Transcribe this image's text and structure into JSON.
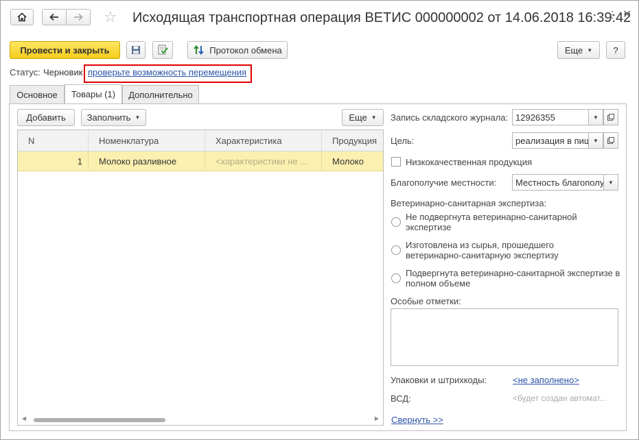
{
  "window": {
    "title": "Исходящая транспортная операция ВЕТИС 000000002 от 14.06.2018 16:39:42"
  },
  "toolbar": {
    "post_close_label": "Провести и закрыть",
    "protocol_label": "Протокол обмена",
    "more_label": "Еще",
    "help_label": "?"
  },
  "status": {
    "label": "Статус:",
    "value": "Черновик",
    "link": "проверьте возможность перемещения"
  },
  "tabs": [
    {
      "label": "Основное"
    },
    {
      "label": "Товары (1)"
    },
    {
      "label": "Дополнительно"
    }
  ],
  "table_toolbar": {
    "add_label": "Добавить",
    "fill_label": "Заполнить",
    "more_label": "Еще"
  },
  "table": {
    "columns": [
      "N",
      "Номенклатура",
      "Характеристика",
      "Продукция"
    ],
    "rows": [
      {
        "n": "1",
        "nomenclature": "Молоко разливное",
        "characteristic": "<характеристики не ...",
        "product": "Молоко"
      }
    ]
  },
  "details": {
    "warehouse_label": "Запись складского журнала:",
    "warehouse_value": "12926355",
    "purpose_label": "Цель:",
    "purpose_value": "реализация в пищ",
    "low_quality_label": "Низкокачественная продукция",
    "wellbeing_label": "Благополучие местности:",
    "wellbeing_value": "Местность благополу",
    "expertise_label": "Ветеринарно-санитарная экспертиза:",
    "expertise_options": [
      {
        "line1": "Не подвергнута ветеринарно-санитарной",
        "line2": "экспертизе"
      },
      {
        "line1": "Изготовлена из сырья, прошедшего",
        "line2": "ветеринарно-санитарную экспертизу"
      },
      {
        "line1": "Подвергнута ветеринарно-санитарной экспертизе в",
        "line2": "полном объеме"
      }
    ],
    "notes_label": "Особые отметки:",
    "notes_value": "",
    "packages_label": "Упаковки и штрихкоды:",
    "packages_value": "<не заполнено>",
    "vsd_label": "ВСД:",
    "vsd_value": "<будет создан автомат...",
    "collapse_label": "Свернуть >>"
  },
  "colors": {
    "accent_yellow": "#f5cc1a",
    "selected_row": "#fbf0b0",
    "link": "#2a53a6",
    "highlight": "#e00000"
  }
}
